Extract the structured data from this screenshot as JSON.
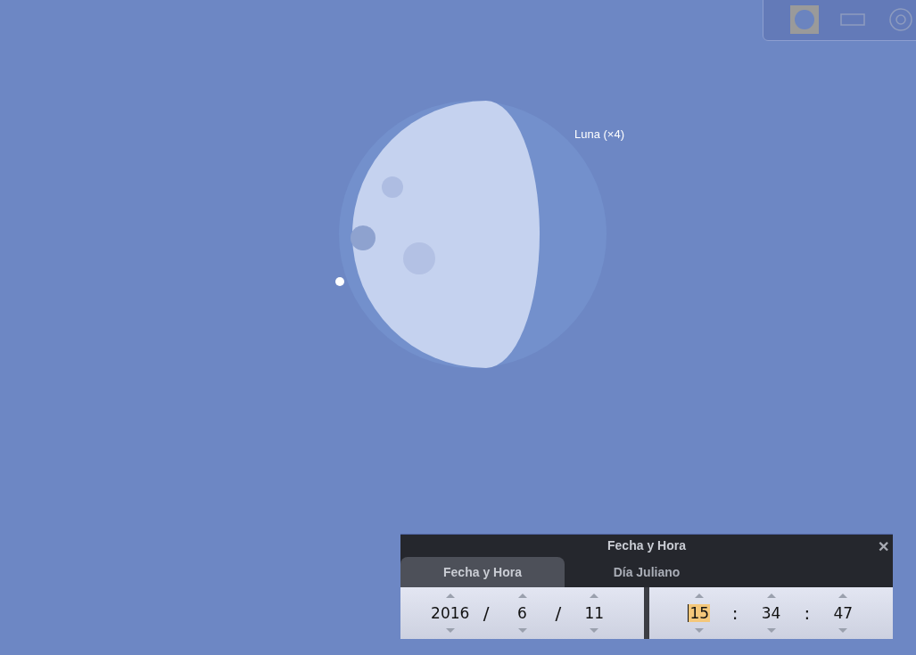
{
  "sky_label": "Luna (×4)",
  "toolbar": [
    {
      "kind": "disc",
      "selected": true
    },
    {
      "kind": "rect",
      "selected": false
    },
    {
      "kind": "rings",
      "selected": false
    }
  ],
  "dialog": {
    "title": "Fecha y Hora",
    "close": "✕",
    "tabs": [
      {
        "label": "Fecha y Hora",
        "selected": true
      },
      {
        "label": "Día Juliano",
        "selected": false
      }
    ],
    "date_fields": [
      {
        "value": "2016",
        "selected": false
      },
      {
        "value": "6",
        "selected": false
      },
      {
        "value": "11",
        "selected": false
      }
    ],
    "date_separators": [
      "/",
      "/"
    ],
    "time_fields": [
      {
        "value": "15",
        "selected": true
      },
      {
        "value": "34",
        "selected": false
      },
      {
        "value": "47",
        "selected": false
      }
    ],
    "time_separators": [
      ":",
      ":"
    ]
  }
}
